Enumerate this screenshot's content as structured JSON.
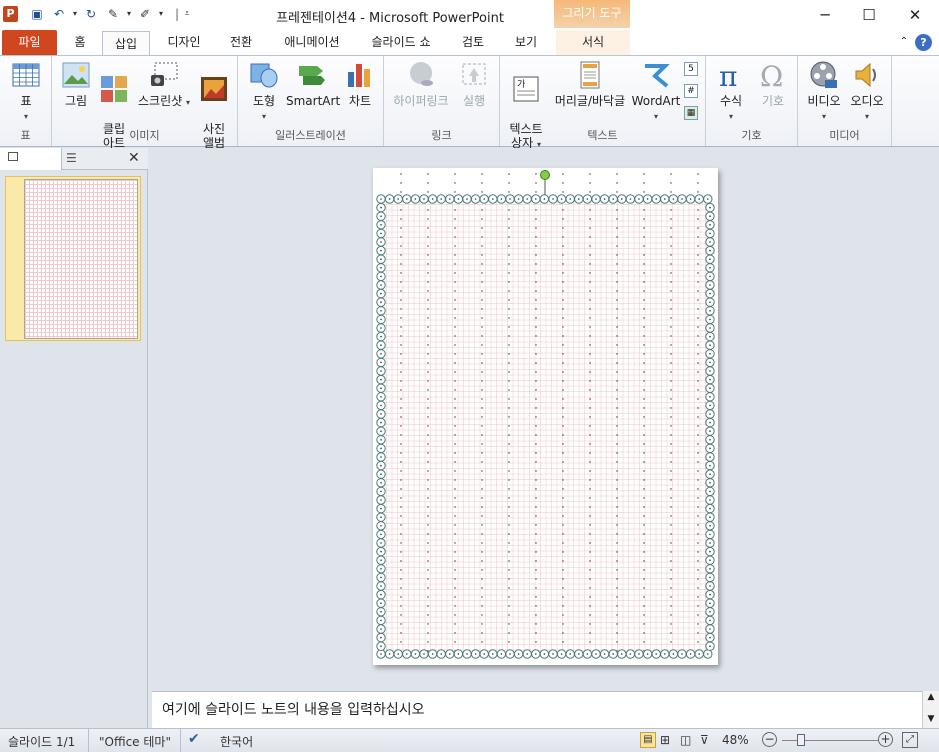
{
  "window": {
    "title": "프레젠테이션4 - Microsoft PowerPoint",
    "context_tab_header": "그리기 도구",
    "buttons": {
      "minimize": "─",
      "maximize": "☐",
      "close": "✕"
    }
  },
  "quick_access": {
    "icons": [
      "save-icon",
      "undo-icon",
      "redo-icon",
      "format-painter-icon",
      "edit-icon",
      "customize-icon"
    ]
  },
  "tabs": [
    {
      "label": "파일"
    },
    {
      "label": "홈"
    },
    {
      "label": "삽입"
    },
    {
      "label": "디자인"
    },
    {
      "label": "전환"
    },
    {
      "label": "애니메이션"
    },
    {
      "label": "슬라이드 쇼"
    },
    {
      "label": "검토"
    },
    {
      "label": "보기"
    },
    {
      "label": "서식"
    }
  ],
  "active_tab": "삽입",
  "ribbon": {
    "groups": [
      {
        "label": "표",
        "buttons": [
          {
            "label": "표"
          }
        ]
      },
      {
        "label": "이미지",
        "buttons": [
          {
            "label": "그림"
          },
          {
            "label": "클립\n아트"
          },
          {
            "label": "스크린샷"
          },
          {
            "label": "사진\n앨범"
          }
        ]
      },
      {
        "label": "일러스트레이션",
        "buttons": [
          {
            "label": "도형"
          },
          {
            "label": "SmartArt"
          },
          {
            "label": "차트"
          }
        ]
      },
      {
        "label": "링크",
        "buttons": [
          {
            "label": "하이퍼링크"
          },
          {
            "label": "실행"
          }
        ]
      },
      {
        "label": "텍스트",
        "buttons": [
          {
            "label": "텍스트\n상자"
          },
          {
            "label": "머리글/바닥글"
          },
          {
            "label": "WordArt"
          }
        ]
      },
      {
        "label": "기호",
        "buttons": [
          {
            "label": "수식"
          },
          {
            "label": "기호"
          }
        ]
      },
      {
        "label": "미디어",
        "buttons": [
          {
            "label": "비디오"
          },
          {
            "label": "오디오"
          }
        ]
      }
    ]
  },
  "slides_pane": {
    "slide_number": "1"
  },
  "notes": {
    "placeholder": "여기에 슬라이드 노트의 내용을 입력하십시오"
  },
  "status": {
    "slide": "슬라이드 1/1",
    "theme": "\"Office 테마\"",
    "language": "한국어",
    "zoom": "48%"
  },
  "colors": {
    "file_tab": "#d0461e",
    "context_tab": "#f6b879",
    "grid_line": "#f0c2c2",
    "border_circle": "#4a7a7a"
  }
}
